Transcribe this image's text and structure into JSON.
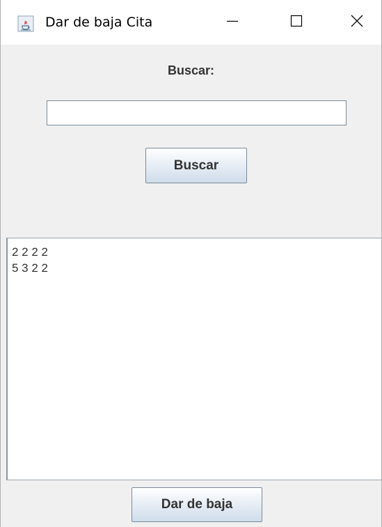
{
  "window": {
    "title": "Dar de baja Cita",
    "app_icon": "java-cup-icon",
    "controls": {
      "minimize_icon": "minimize-icon",
      "maximize_icon": "maximize-icon",
      "close_icon": "close-icon"
    }
  },
  "search": {
    "label": "Buscar:",
    "input_value": "",
    "button_label": "Buscar"
  },
  "results": {
    "lines": [
      "2 2 2 2",
      "5 3 2 2"
    ]
  },
  "footer": {
    "button_label": "Dar de baja"
  },
  "colors": {
    "panel_background": "#f0f0f0",
    "titlebar_background": "#ffffff",
    "button_gradient_bottom": "#cfdcea",
    "border": "#7a8a99"
  }
}
